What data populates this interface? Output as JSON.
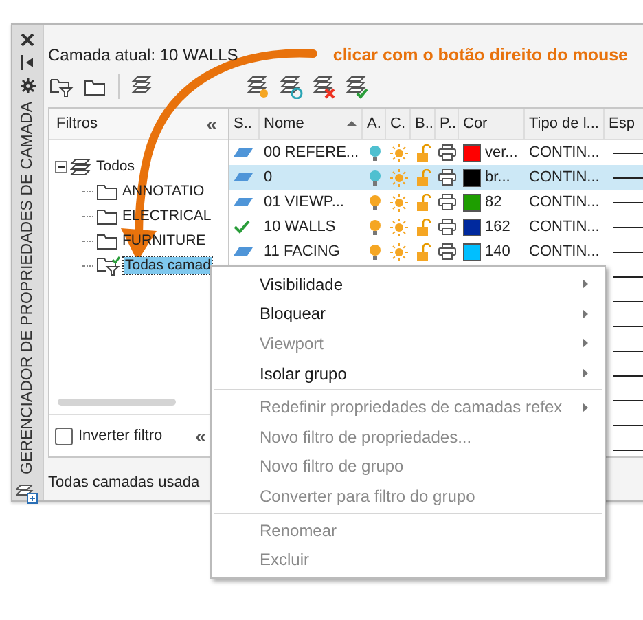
{
  "side_title": "GERENCIADOR DE PROPRIEDADES DE CAMADA",
  "current_layer": "Camada atual: 10 WALLS",
  "annotation": "clicar com o botão direito do mouse",
  "filters": {
    "title": "Filtros",
    "collapse": "«",
    "tree": [
      {
        "label": "Todos",
        "expanded": true,
        "selected": false,
        "kind": "all",
        "children": [
          {
            "label": "ANNOTATIO",
            "selected": false,
            "kind": "group"
          },
          {
            "label": "ELECTRICAL",
            "selected": false,
            "kind": "group"
          },
          {
            "label": "FURNITURE",
            "selected": false,
            "kind": "group"
          },
          {
            "label": "Todas camad",
            "selected": true,
            "kind": "used"
          }
        ]
      }
    ],
    "invert": {
      "label": "Inverter filtro",
      "checked": false
    },
    "collapse_bottom": "«"
  },
  "columns": [
    "S..",
    "Nome",
    "A.",
    "C.",
    "B..",
    "P..",
    "Cor",
    "Tipo de l...",
    "Esp"
  ],
  "rows": [
    {
      "kind": "layer",
      "current": false,
      "name": "00 REFERE...",
      "on": false,
      "color": "#ff0000",
      "color_name": "ver...",
      "linetype": "CONTIN...",
      "selected": false
    },
    {
      "kind": "layer",
      "current": false,
      "name": "0",
      "on": false,
      "color": "#000000",
      "color_name": "br...",
      "linetype": "CONTIN...",
      "selected": true
    },
    {
      "kind": "layer",
      "current": false,
      "name": "01 VIEWP...",
      "on": true,
      "color": "#1e9e00",
      "color_name": "82",
      "linetype": "CONTIN...",
      "selected": false
    },
    {
      "kind": "layer",
      "current": true,
      "name": "10 WALLS",
      "on": true,
      "color": "#00299e",
      "color_name": "162",
      "linetype": "CONTIN...",
      "selected": false
    },
    {
      "kind": "layer",
      "current": false,
      "name": "11 FACING",
      "on": true,
      "color": "#00bfff",
      "color_name": "140",
      "linetype": "CONTIN...",
      "selected": false
    },
    {
      "kind": "covered"
    },
    {
      "kind": "covered"
    },
    {
      "kind": "covered"
    },
    {
      "kind": "covered"
    },
    {
      "kind": "covered"
    },
    {
      "kind": "covered"
    },
    {
      "kind": "covered"
    },
    {
      "kind": "covered"
    }
  ],
  "status": "Todas camadas usada",
  "menu": [
    {
      "label": "Visibilidade",
      "disabled": false,
      "submenu": true,
      "separator_after": false
    },
    {
      "label": "Bloquear",
      "disabled": false,
      "submenu": true,
      "separator_after": false
    },
    {
      "label": "Viewport",
      "disabled": true,
      "submenu": true,
      "separator_after": false
    },
    {
      "label": "Isolar grupo",
      "disabled": false,
      "submenu": true,
      "separator_after": true
    },
    {
      "label": "Redefinir propriedades de camadas refex",
      "disabled": true,
      "submenu": true,
      "separator_after": false
    },
    {
      "label": "Novo filtro de propriedades...",
      "disabled": true,
      "submenu": false,
      "separator_after": false
    },
    {
      "label": "Novo filtro de grupo",
      "disabled": true,
      "submenu": false,
      "separator_after": false
    },
    {
      "label": "Converter para filtro do grupo",
      "disabled": true,
      "submenu": false,
      "separator_after": true
    },
    {
      "label": "Renomear",
      "disabled": true,
      "submenu": false,
      "separator_after": false
    },
    {
      "label": "Excluir",
      "disabled": true,
      "submenu": false,
      "separator_after": false
    }
  ]
}
